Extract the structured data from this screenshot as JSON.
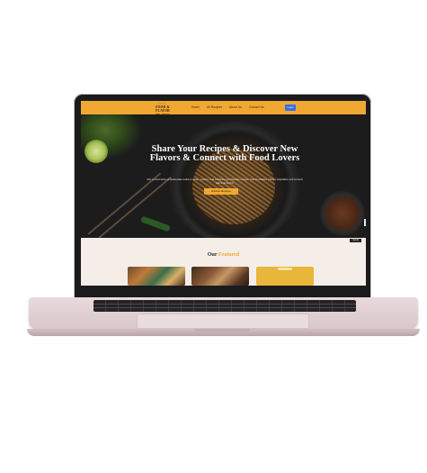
{
  "nav": {
    "logo_top": "~ ~ ~",
    "logo_name": "FOOD & FLAVOR",
    "logo_sub": "share · discover",
    "links": [
      "Home",
      "All Recipes",
      "About Us",
      "Contact Us"
    ],
    "login": "Login"
  },
  "hero": {
    "title": "Share Your Recipes & Discover New Flavors & Connect with Food Lovers",
    "subtitle": "Join a community of passionate cooks to share, explore, and celebrate your favorite recipes. Unlock endless culinary inspiration and connect with food lovers.",
    "cta": "Explore Recipes"
  },
  "featured": {
    "chip": "Scroll",
    "title_a": "Our",
    "title_b": "Featured"
  },
  "colors": {
    "accent": "#f1a832",
    "login_blue": "#2f6fe8",
    "hero_bg": "#1c1c1c",
    "featured_bg": "#f5ede8",
    "laptop_body": "#e2d3d6"
  }
}
